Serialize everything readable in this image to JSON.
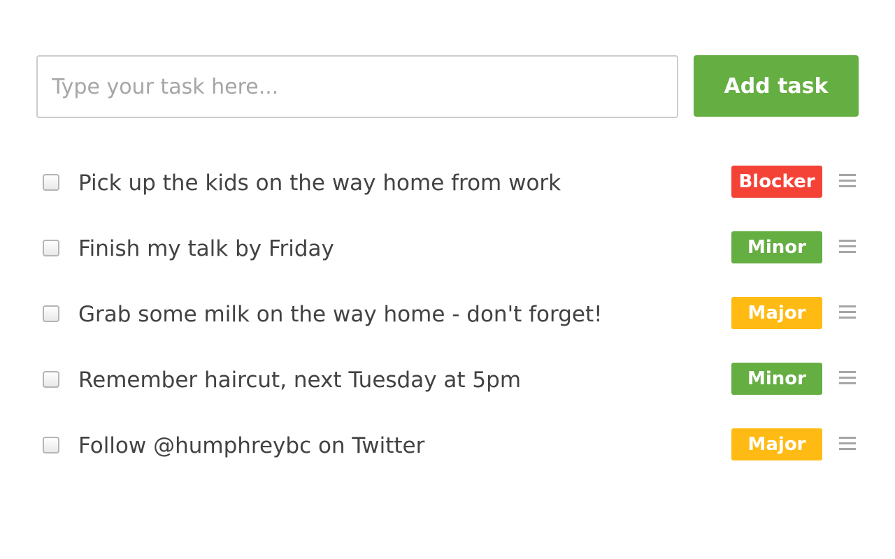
{
  "colors": {
    "green": "#65ae42",
    "red": "#f44336",
    "yellow": "#ffbb14"
  },
  "add_form": {
    "input_value": "",
    "input_placeholder": "Type your task here...",
    "button_label": "Add task"
  },
  "tasks": [
    {
      "text": "Pick up the kids on the way home from work",
      "priority": "Blocker",
      "color": "#f44336",
      "checked": false
    },
    {
      "text": "Finish my talk by Friday",
      "priority": "Minor",
      "color": "#65ae42",
      "checked": false
    },
    {
      "text": "Grab some milk on the way home - don't forget!",
      "priority": "Major",
      "color": "#ffbb14",
      "checked": false
    },
    {
      "text": "Remember haircut, next Tuesday at 5pm",
      "priority": "Minor",
      "color": "#65ae42",
      "checked": false
    },
    {
      "text": "Follow @humphreybc on Twitter",
      "priority": "Major",
      "color": "#ffbb14",
      "checked": false
    }
  ]
}
